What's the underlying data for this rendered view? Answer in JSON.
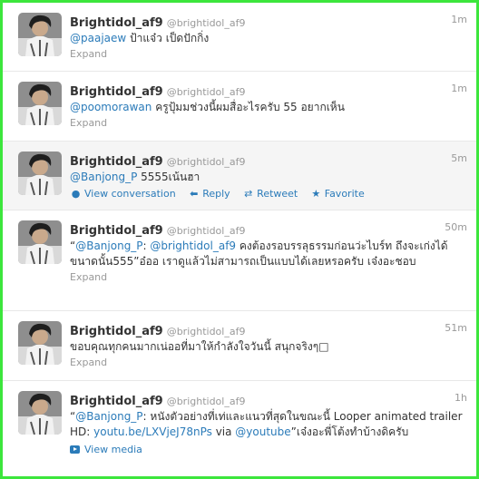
{
  "tweets": [
    {
      "name": "Brightidol_af9",
      "handle": "@brightidol_af9",
      "time": "1m",
      "mention": "@paajaew",
      "text": " ป้าแจ๋ว เป็ดปักกิ่ง",
      "expand": "Expand"
    },
    {
      "name": "Brightidol_af9",
      "handle": "@brightidol_af9",
      "time": "1m",
      "mention": "@poomorawan",
      "text": " ครูปุ้มมช่วงนี้ผมสื่อะไรครับ 55 อยากเห็น",
      "expand": "Expand"
    },
    {
      "name": "Brightidol_af9",
      "handle": "@brightidol_af9",
      "time": "5m",
      "mention": "@Banjong_P",
      "text": " 5555เน้นฮา",
      "actions": {
        "view_conversation": "View conversation",
        "reply": "Reply",
        "retweet": "Retweet",
        "favorite": "Favorite"
      }
    },
    {
      "name": "Brightidol_af9",
      "handle": "@brightidol_af9",
      "time": "50m",
      "quote_open": "“",
      "mention1": "@Banjong_P",
      "colon": ": ",
      "mention2": "@brightidol_af9",
      "text": " คงต้องรอบรรลุธรรมก่อนว่ะไบร์ท ถึงจะเก่งได้ขนาดนั้น555”อ๋ออ เราดูแล้วไม่สามารถเป็นแบบได้เลยหรอครับ เจ๋งอะชอบ",
      "expand": "Expand"
    },
    {
      "name": "Brightidol_af9",
      "handle": "@brightidol_af9",
      "time": "51m",
      "text": "ขอบคุณทุกคนมากเน่ออที่มาให้กำลังใจวันนี้ สนุกจริงๆ□",
      "expand": "Expand"
    },
    {
      "name": "Brightidol_af9",
      "handle": "@brightidol_af9",
      "time": "1h",
      "quote_open": "“",
      "mention1": "@Banjong_P",
      "text1": ": หนังตัวอย่างที่เท่และแนวที่สุดในขณะนี้ Looper animated trailer HD: ",
      "url": "youtu.be/LXVjeJ78nPs",
      "via": " via ",
      "mention2": "@youtube",
      "text2": "”เจ๋งอะพี่โต้งทำบ้างดิครับ",
      "view_media": "View media"
    }
  ],
  "colors": {
    "border": "#3ce63c",
    "link": "#2b7bb9",
    "muted": "#999999",
    "text": "#333333",
    "highlight": "#f5f5f5"
  }
}
